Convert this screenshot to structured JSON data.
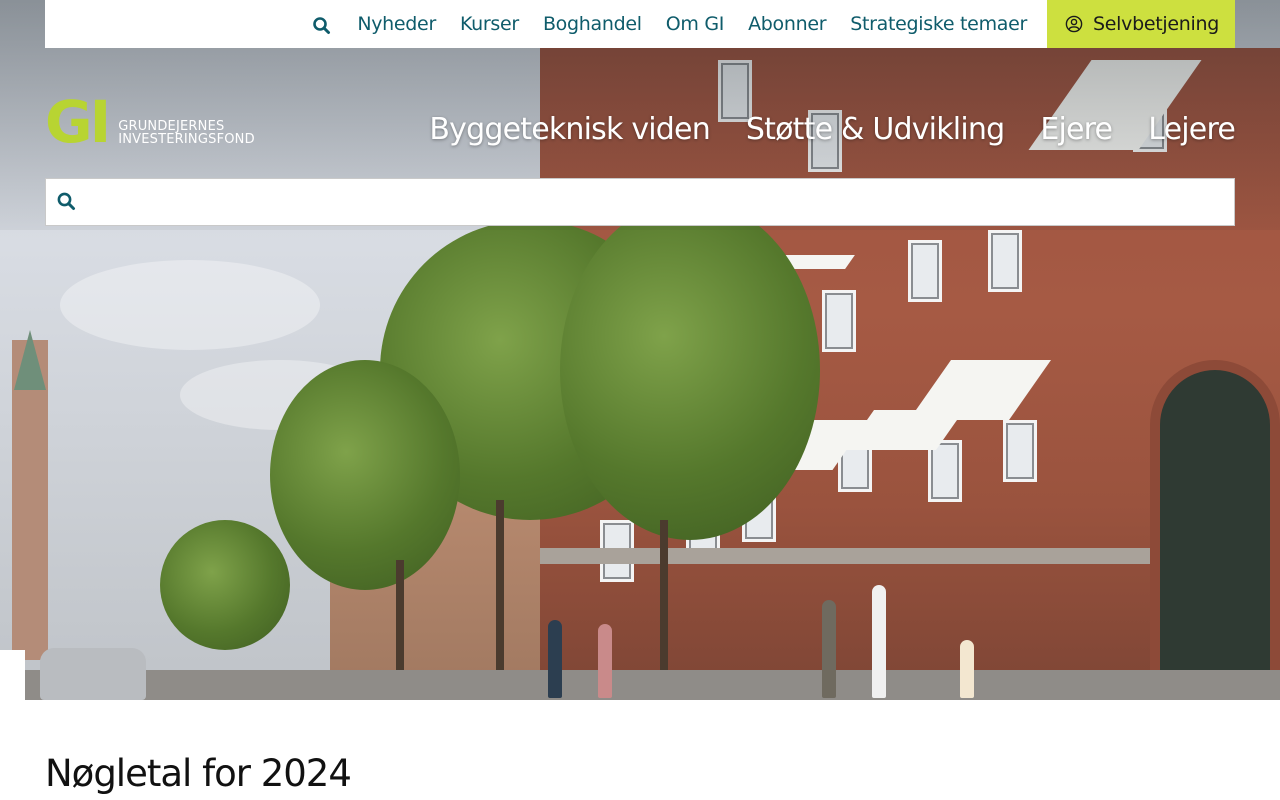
{
  "topnav": {
    "items": [
      {
        "label": "Nyheder"
      },
      {
        "label": "Kurser"
      },
      {
        "label": "Boghandel"
      },
      {
        "label": "Om GI"
      },
      {
        "label": "Abonner"
      },
      {
        "label": "Strategiske temaer"
      }
    ],
    "selfservice_label": "Selvbetjening"
  },
  "logo": {
    "mark": "GI",
    "line1": "GRUNDEJERNES",
    "line2": "INVESTERINGSFOND"
  },
  "mainnav": {
    "items": [
      {
        "label": "Byggeteknisk viden"
      },
      {
        "label": "Støtte & Udvikling"
      },
      {
        "label": "Ejere"
      },
      {
        "label": "Lejere"
      }
    ]
  },
  "search": {
    "value": "",
    "placeholder": ""
  },
  "page": {
    "title": "Nøgletal for 2024"
  },
  "colors": {
    "brand_green": "#b8d432",
    "accent_teal": "#0f5c6b",
    "selfservice_bg": "#cde03f"
  },
  "icons": {
    "top_search": "search-icon",
    "selfservice": "user-circle-icon",
    "bar_search": "search-icon"
  }
}
